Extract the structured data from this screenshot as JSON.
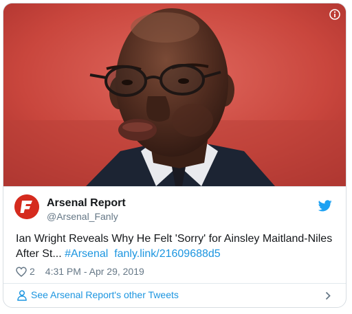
{
  "tweet": {
    "author_name": "Arsenal Report",
    "author_handle": "@Arsenal_Fanly",
    "text_prefix": "Ian Wright Reveals Why He Felt 'Sorry' for Ainsley Maitland-Niles After St... ",
    "hashtag": "#Arsenal",
    "link": "fanly.link/21609688d5",
    "like_count": "2",
    "timestamp": "4:31 PM - Apr 29, 2019",
    "more_tweets_label": "See Arsenal Report's other Tweets"
  },
  "icons": {
    "info": "info-icon",
    "bird": "twitter-bird-icon",
    "heart": "heart-icon",
    "person": "person-icon",
    "chevron": "chevron-right-icon",
    "avatar_logo": "fanly-f-logo"
  },
  "colors": {
    "link": "#1b95e0",
    "text": "#14171a",
    "muted": "#657786",
    "avatar": "#d52b1e"
  }
}
